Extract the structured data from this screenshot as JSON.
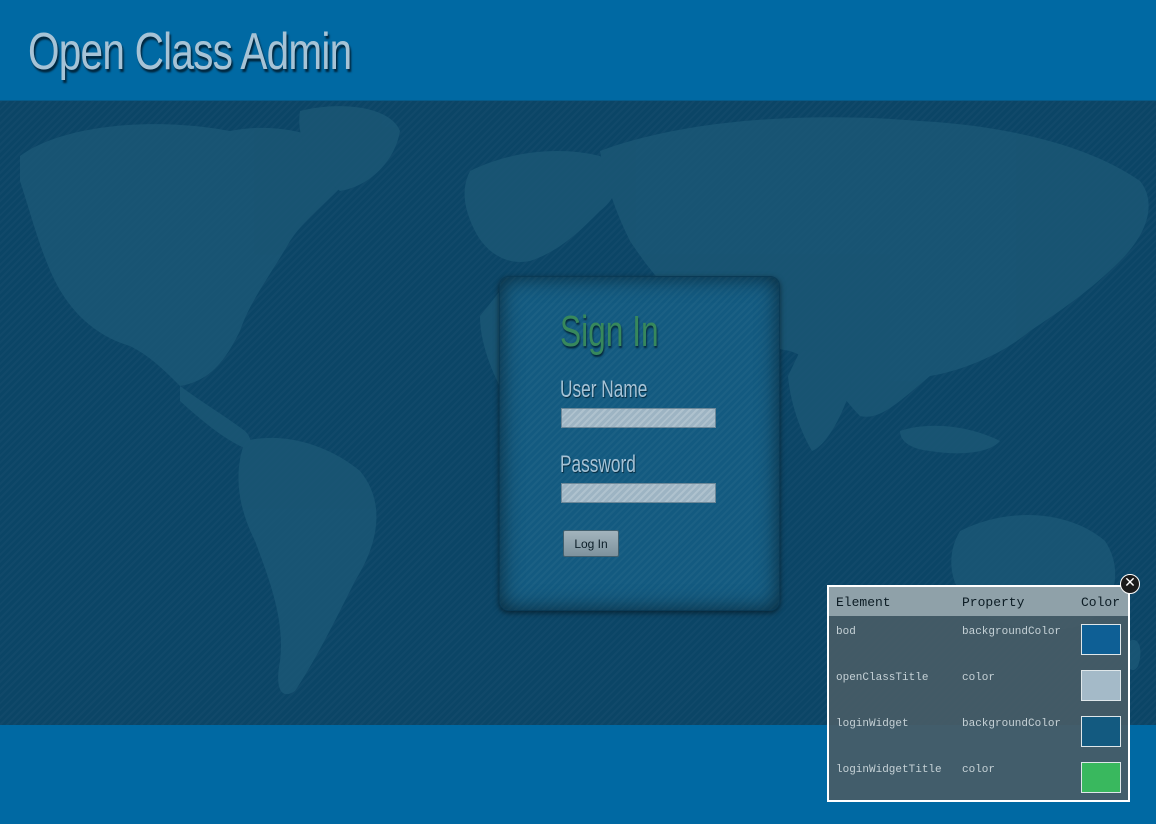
{
  "header": {
    "title": "Open Class Admin"
  },
  "login": {
    "title": "Sign In",
    "username_label": "User Name",
    "username_value": "",
    "password_label": "Password",
    "password_value": "",
    "submit_label": "Log In"
  },
  "color_panel": {
    "columns": [
      "Element",
      "Property",
      "Color"
    ],
    "rows": [
      {
        "element": "bod",
        "property": "backgroundColor",
        "color": "#0e5f95"
      },
      {
        "element": "openClassTitle",
        "property": "color",
        "color": "#a4bac8"
      },
      {
        "element": "loginWidget",
        "property": "backgroundColor",
        "color": "#135a80"
      },
      {
        "element": "loginWidgetTitle",
        "property": "color",
        "color": "#39b85e"
      }
    ],
    "close_icon": "close-icon"
  },
  "colors": {
    "header_bg": "#0069a3",
    "map_bg": "#0b4566",
    "title_color": "#a6c3d6",
    "login_title_color": "#37885c"
  }
}
